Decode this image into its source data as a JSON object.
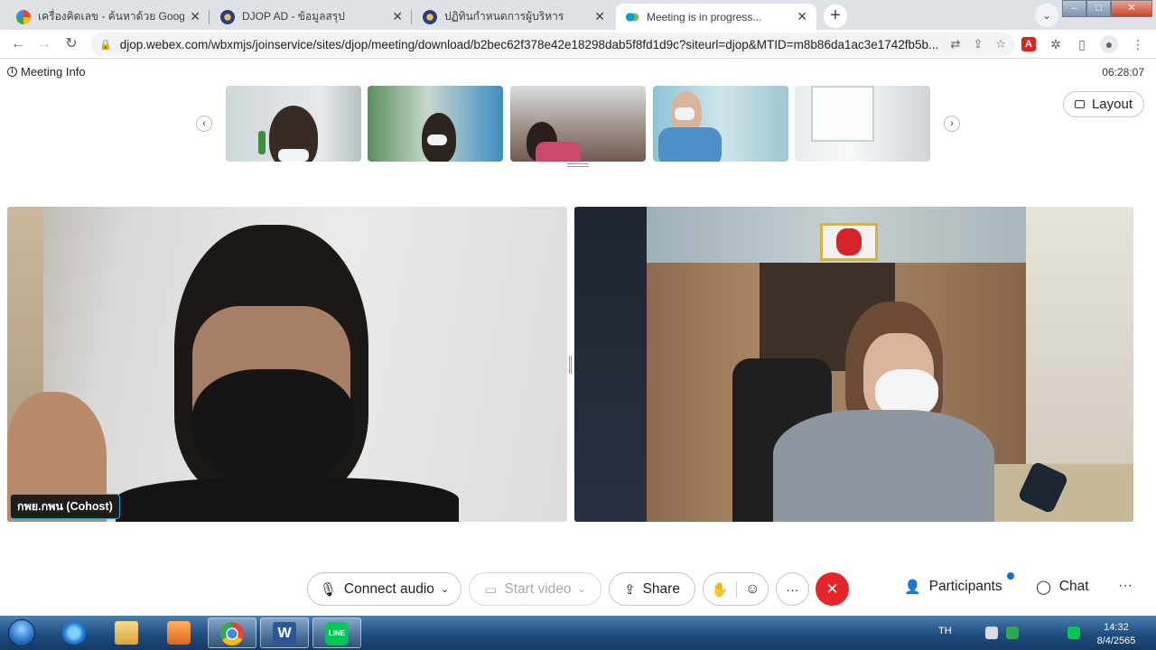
{
  "browser": {
    "tabs": [
      {
        "title": "เครื่องคิดเลข - ค้นหาด้วย Google",
        "favicon": "google-icon",
        "active": false
      },
      {
        "title": "DJOP AD - ข้อมูลสรุป",
        "favicon": "djop-seal-icon",
        "active": false
      },
      {
        "title": "ปฏิทินกำหนดการผู้บริหาร",
        "favicon": "djop-seal-icon",
        "active": false
      },
      {
        "title": "Meeting is in progress...",
        "favicon": "webex-icon",
        "active": true
      }
    ],
    "url": "djop.webex.com/wbxmjs/joinservice/sites/djop/meeting/download/b2bec62f378e42e18298dab5f8fd1d9c?siteurl=djop&MTID=m8b86da1ac3e1742fb5b..."
  },
  "meeting": {
    "info_label": "Meeting Info",
    "elapsed": "06:28:07",
    "layout_label": "Layout",
    "tiles": [
      {
        "name_tag": "กพย.กพน (Cohost)"
      },
      {
        "name_tag": ""
      }
    ]
  },
  "controls": {
    "connect_audio": "Connect audio",
    "start_video": "Start video",
    "share": "Share",
    "participants": "Participants",
    "chat": "Chat"
  },
  "taskbar": {
    "language": "TH",
    "time": "14:32",
    "date": "8/4/2565"
  },
  "colors": {
    "end_call": "#e5252a",
    "active_speaker_border": "#2aa3e0",
    "notification_dot": "#1170cf"
  }
}
